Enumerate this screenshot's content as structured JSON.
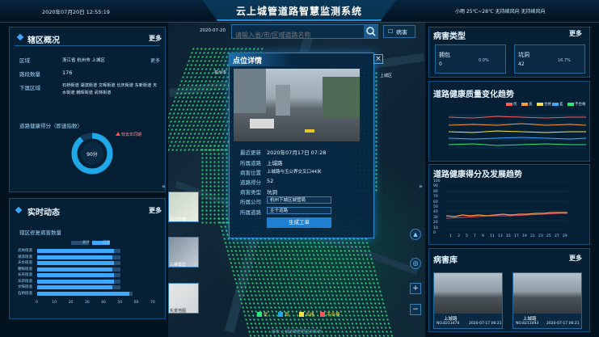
{
  "header": {
    "datetime": "2020年07月20日 12:55:19",
    "title": "云上城管道路智慧监测系统",
    "weather": "小雨 25℃~28℃ 无持续风向 无持续风向"
  },
  "district": {
    "title": "辖区概况",
    "more": "更多",
    "region_label": "区域",
    "region_value": "浙江省 杭州市 上城区",
    "region_extra": "更多",
    "road_count_label": "路段数量",
    "road_count_value": "176",
    "streets_label": "下属区域",
    "streets_value": "石桥街道 湖滨街道 文晖街道 长庆街道 东新街道 天水街道 朝晖街道 武林街道",
    "score_label": "道路健康得分（即速指数）",
    "score_value": "90分",
    "score_tag": "较去年同期",
    "score_fraction": 0.9
  },
  "realtime": {
    "title": "实时动态",
    "more": "更多",
    "subtitle": "辖区修复病害数量",
    "legend": [
      "总计",
      "已修"
    ],
    "streets": [
      "武林街道",
      "湖滨街道",
      "天水街道",
      "朝晖街道",
      "长庆街道",
      "东新街道",
      "文晖街道",
      "石桥街道"
    ],
    "totals": [
      51,
      51,
      51,
      51,
      51,
      51,
      51,
      58
    ],
    "repaired": [
      47,
      46,
      47,
      46,
      47,
      47,
      46,
      56
    ],
    "x_ticks": [
      "0",
      "10",
      "20",
      "30",
      "40",
      "50",
      "60",
      "70"
    ]
  },
  "map": {
    "date": "2020-07-20",
    "search_placeholder": "请输入省/市/区域道路名称",
    "filter_label": "病害",
    "labels": [
      "杭州市",
      "上城区",
      "杭州市",
      "上城区"
    ],
    "legend": [
      "优",
      "良",
      "合格",
      "不合格"
    ],
    "thumbs": [
      "历史影像",
      "三维模型",
      "实景地图"
    ],
    "footer": "版权 上城道路智慧监测系统"
  },
  "popup": {
    "title": "点位详情",
    "update_label": "最近更新",
    "update_value": "2020年07月17日 07:28",
    "road_label": "所属道路",
    "road_value": "上城路",
    "location_label": "病害位置",
    "location_value": "上城路与玉公界交叉口44米",
    "score_label": "道路得分",
    "score_value": "52",
    "type_label": "病害类型",
    "type_value": "坑洞",
    "company_label": "所属公司",
    "company_value": "杭州下城区城管局",
    "street_label": "所属道路",
    "street_value": "主干道路",
    "button": "生成工单"
  },
  "disease_type": {
    "title": "病害类型",
    "more": "更多",
    "cards": [
      {
        "name": "拥包",
        "count": "0",
        "pct": "0.0%"
      },
      {
        "name": "坑洞",
        "count": "42",
        "pct": "16.7%"
      }
    ]
  },
  "quality_trend": {
    "title": "道路健康质量变化趋势",
    "legend": [
      "优",
      "良",
      "合格",
      "差",
      "不合格"
    ]
  },
  "score_trend": {
    "title": "道路健康得分及发展趋势",
    "y_ticks": [
      "100",
      "90",
      "80",
      "70",
      "60",
      "50",
      "40",
      "30",
      "20",
      "10",
      "0"
    ],
    "x_ticks": [
      "1",
      "3",
      "5",
      "7",
      "9",
      "11",
      "13",
      "15",
      "17",
      "19",
      "21",
      "23",
      "25",
      "27",
      "29"
    ]
  },
  "library": {
    "title": "病害库",
    "more": "更多",
    "items": [
      {
        "road": "上城路",
        "date": "2020-07-17 06:21",
        "id": "NO.8213478"
      },
      {
        "road": "上城路",
        "date": "2020-07-17 06:21",
        "id": "NO.8213493"
      }
    ]
  },
  "colors": {
    "accent": "#3ea7ff",
    "good": "#2ee87a",
    "bg": "#03121f"
  }
}
